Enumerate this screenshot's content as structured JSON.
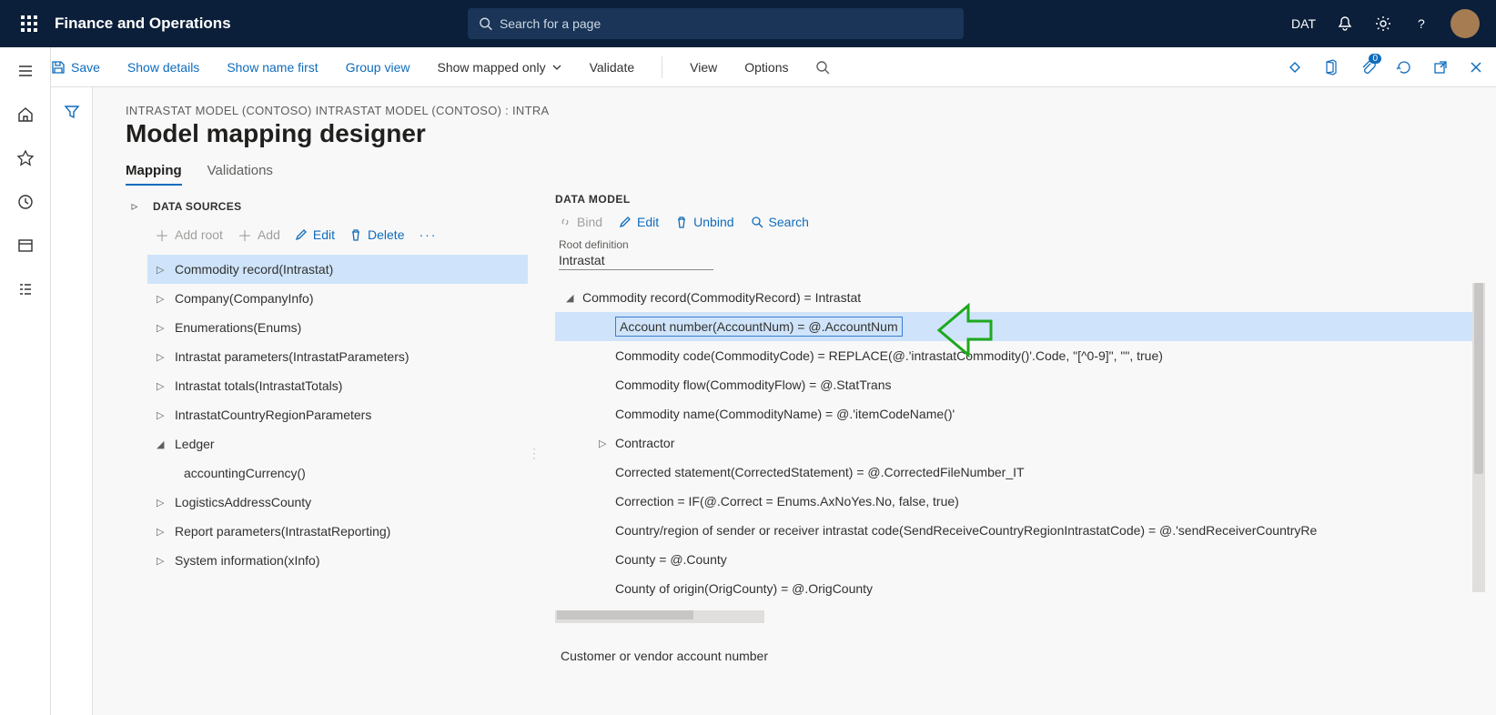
{
  "topbar": {
    "brand": "Finance and Operations",
    "search_placeholder": "Search for a page",
    "company": "DAT"
  },
  "cmdbar": {
    "save": "Save",
    "show_details": "Show details",
    "show_name_first": "Show name first",
    "group_view": "Group view",
    "show_mapped": "Show mapped only",
    "validate": "Validate",
    "view": "View",
    "options": "Options",
    "badge_count": "0"
  },
  "page": {
    "breadcrumb": "INTRASTAT MODEL (CONTOSO) INTRASTAT MODEL (CONTOSO) : INTRA",
    "title": "Model mapping designer",
    "tab_mapping": "Mapping",
    "tab_validations": "Validations"
  },
  "ds": {
    "header": "DATA SOURCES",
    "add_root": "Add root",
    "add": "Add",
    "edit": "Edit",
    "delete": "Delete",
    "items": [
      {
        "label": "Commodity record(Intrastat)",
        "selected": true,
        "exp": "closed"
      },
      {
        "label": "Company(CompanyInfo)",
        "exp": "closed"
      },
      {
        "label": "Enumerations(Enums)",
        "exp": "closed"
      },
      {
        "label": "Intrastat parameters(IntrastatParameters)",
        "exp": "closed"
      },
      {
        "label": "Intrastat totals(IntrastatTotals)",
        "exp": "closed"
      },
      {
        "label": "IntrastatCountryRegionParameters",
        "exp": "closed"
      },
      {
        "label": "Ledger",
        "exp": "open",
        "children": [
          "accountingCurrency()"
        ]
      },
      {
        "label": "LogisticsAddressCounty",
        "exp": "closed"
      },
      {
        "label": "Report parameters(IntrastatReporting)",
        "exp": "closed"
      },
      {
        "label": "System information(xInfo)",
        "exp": "closed"
      }
    ]
  },
  "dm": {
    "header": "DATA MODEL",
    "bind": "Bind",
    "edit": "Edit",
    "unbind": "Unbind",
    "search": "Search",
    "root_def_label": "Root definition",
    "root_def_value": "Intrastat",
    "rows": [
      {
        "lvl": 0,
        "arrow": "open",
        "txt": "Commodity record(CommodityRecord) = Intrastat"
      },
      {
        "lvl": 1,
        "arrow": "",
        "txt": "Account number(AccountNum) = @.AccountNum",
        "selected": true
      },
      {
        "lvl": 1,
        "arrow": "",
        "txt": "Commodity code(CommodityCode) = REPLACE(@.'intrastatCommodity()'.Code, \"[^0-9]\", \"\", true)"
      },
      {
        "lvl": 1,
        "arrow": "",
        "txt": "Commodity flow(CommodityFlow) = @.StatTrans"
      },
      {
        "lvl": 1,
        "arrow": "",
        "txt": "Commodity name(CommodityName) = @.'itemCodeName()'"
      },
      {
        "lvl": 1,
        "arrow": "closed",
        "txt": "Contractor"
      },
      {
        "lvl": 1,
        "arrow": "",
        "txt": "Corrected statement(CorrectedStatement) = @.CorrectedFileNumber_IT"
      },
      {
        "lvl": 1,
        "arrow": "",
        "txt": "Correction = IF(@.Correct = Enums.AxNoYes.No, false, true)"
      },
      {
        "lvl": 1,
        "arrow": "",
        "txt": "Country/region of sender or receiver intrastat code(SendReceiveCountryRegionIntrastatCode) = @.'sendReceiverCountryRe"
      },
      {
        "lvl": 1,
        "arrow": "",
        "txt": "County = @.County"
      },
      {
        "lvl": 1,
        "arrow": "",
        "txt": "County of origin(OrigCounty) = @.OrigCounty"
      }
    ],
    "footer": "Customer or vendor account number"
  }
}
